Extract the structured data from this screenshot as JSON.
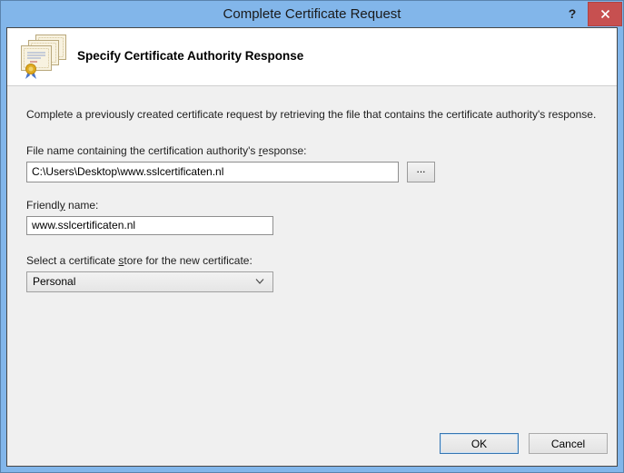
{
  "window": {
    "title": "Complete Certificate Request",
    "help_label": "?"
  },
  "header": {
    "title": "Specify Certificate Authority Response",
    "icon": "certificates-icon"
  },
  "body": {
    "description": "Complete a previously created certificate request by retrieving the file that contains the certificate authority's response."
  },
  "fields": {
    "file_response": {
      "label_pre": "File name containing the certification authority's ",
      "label_key": "r",
      "label_post": "esponse:",
      "value": "C:\\Users\\Desktop\\www.sslcertificaten.nl",
      "browse_label": "..."
    },
    "friendly_name": {
      "label_pre": "Friendl",
      "label_key": "y",
      "label_post": " name:",
      "value": "www.sslcertificaten.nl"
    },
    "certificate_store": {
      "label_pre": "Select a certificate ",
      "label_key": "s",
      "label_post": "tore for the new certificate:",
      "value": "Personal"
    }
  },
  "footer": {
    "ok_label": "OK",
    "cancel_label": "Cancel"
  },
  "colors": {
    "titlebar": "#82b6ea",
    "close_button": "#c75050",
    "header_bg": "#ffffff",
    "body_bg": "#f0f0f0",
    "default_button_border": "#3576b2"
  }
}
